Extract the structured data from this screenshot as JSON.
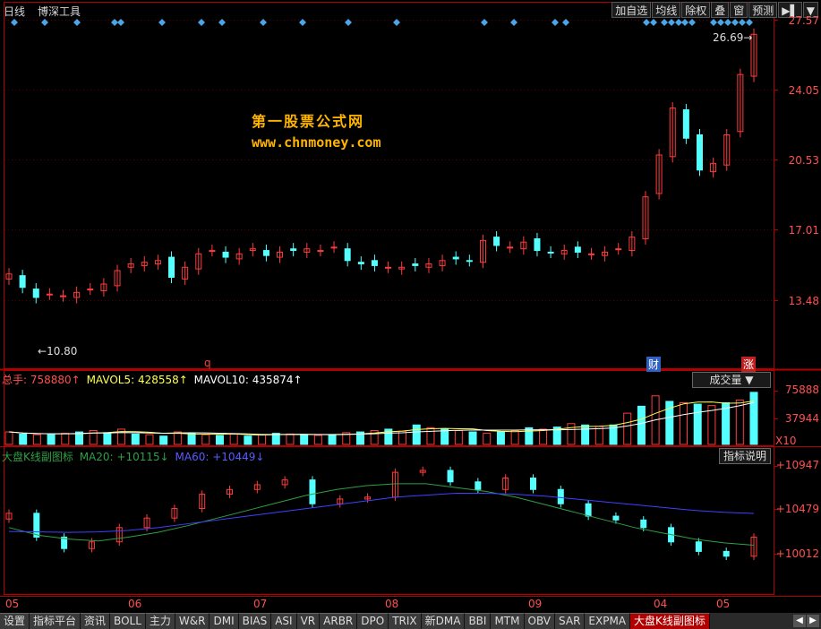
{
  "header": {
    "period": "日线",
    "tool": "博深工具"
  },
  "toolbar": [
    {
      "name": "add-watch-button",
      "label": "加自选"
    },
    {
      "name": "ma-button",
      "label": "均线"
    },
    {
      "name": "exright-button",
      "label": "除权"
    },
    {
      "name": "overlay-button",
      "label": "叠"
    },
    {
      "name": "window-button",
      "label": "窗"
    },
    {
      "name": "predict-button",
      "label": "预测"
    },
    {
      "name": "nav-arrow-button",
      "label": "▶▌"
    },
    {
      "name": "dropdown-button",
      "label": "▼"
    }
  ],
  "price_axis": [
    "27.57",
    "24.05",
    "20.53",
    "17.01",
    "13.48"
  ],
  "annotations": {
    "high": "26.69",
    "low": "10.80",
    "mark_q": "q",
    "mark_cai": "财",
    "mark_zhang": "涨"
  },
  "watermark": {
    "line1": "第一股票公式网",
    "line2": "www.chnmoney.com"
  },
  "volume": {
    "label_total": "总手: 758880↑",
    "label_mavol5": "MAVOL5: 428558↑",
    "label_mavol10": "MAVOL10: 435874↑",
    "dropdown": "成交量",
    "axis": [
      "75888",
      "37944"
    ],
    "unit": "X10"
  },
  "indicator": {
    "name": "大盘K线副图标",
    "ma20": "MA20: +10115↓",
    "ma60": "MA60: +10449↓",
    "button": "指标说明",
    "axis": [
      "+10947",
      "+10479",
      "+10012"
    ]
  },
  "x_axis": [
    "05",
    "06",
    "07",
    "08",
    "09",
    "04",
    "05"
  ],
  "tabs": [
    "设置",
    "指标平台",
    "资讯",
    "BOLL",
    "主力",
    "W&R",
    "DMI",
    "BIAS",
    "ASI",
    "VR",
    "ARBR",
    "DPO",
    "TRIX",
    "新DMA",
    "BBI",
    "MTM",
    "OBV",
    "SAR",
    "EXPMA",
    "大盘K线副图标"
  ],
  "colors": {
    "up": "#ff3c3c",
    "down": "#54ffff",
    "border": "#b00000",
    "ma20": "#2ea043",
    "ma60": "#4040ff",
    "diamond": "#4aa6e8",
    "accent": "#ffb400"
  },
  "chart_data": {
    "type": "candlestick",
    "price_range": [
      10.0,
      27.57
    ],
    "high_price": 26.69,
    "low_price": 10.8,
    "close_series": [
      12.4,
      11.6,
      11.0,
      11.2,
      11.1,
      11.3,
      11.5,
      11.8,
      12.6,
      13.0,
      13.1,
      13.2,
      12.2,
      12.8,
      13.6,
      13.8,
      13.4,
      13.6,
      13.9,
      13.5,
      13.7,
      13.8,
      13.9,
      13.8,
      14.0,
      13.2,
      13.0,
      12.9,
      12.8,
      12.8,
      12.9,
      13.0,
      13.2,
      13.3,
      13.2,
      14.4,
      14.1,
      14.0,
      14.3,
      13.8,
      13.7,
      13.8,
      13.7,
      13.6,
      13.7,
      13.9,
      14.6,
      17.0,
      19.5,
      22.3,
      20.5,
      18.6,
      19.0,
      20.7,
      24.3,
      26.7
    ],
    "volume_series": [
      18,
      15,
      14,
      14,
      16,
      18,
      20,
      17,
      22,
      15,
      14,
      12,
      18,
      16,
      14,
      13,
      15,
      12,
      14,
      16,
      15,
      14,
      13,
      14,
      17,
      18,
      20,
      22,
      19,
      28,
      24,
      22,
      20,
      18,
      16,
      18,
      20,
      24,
      22,
      25,
      30,
      28,
      26,
      28,
      45,
      55,
      70,
      62,
      60,
      58,
      56,
      60,
      64,
      75
    ],
    "indicator_close": [
      10450,
      10200,
      10080,
      10150,
      10300,
      10400,
      10500,
      10650,
      10700,
      10750,
      10800,
      10550,
      10600,
      10620,
      10880,
      10900,
      10780,
      10700,
      10820,
      10700,
      10550,
      10420,
      10380,
      10300,
      10150,
      10050,
      10000,
      10200
    ],
    "ma20_series": [
      10300,
      10220,
      10180,
      10160,
      10200,
      10250,
      10320,
      10400,
      10480,
      10560,
      10640,
      10700,
      10740,
      10760,
      10760,
      10720,
      10680,
      10620,
      10540,
      10460,
      10380,
      10300,
      10240,
      10180,
      10140,
      10115
    ],
    "ma60_series": [
      10260,
      10255,
      10250,
      10255,
      10270,
      10300,
      10340,
      10380,
      10420,
      10460,
      10500,
      10540,
      10580,
      10620,
      10640,
      10660,
      10660,
      10650,
      10630,
      10600,
      10570,
      10540,
      10510,
      10480,
      10460,
      10449
    ]
  }
}
